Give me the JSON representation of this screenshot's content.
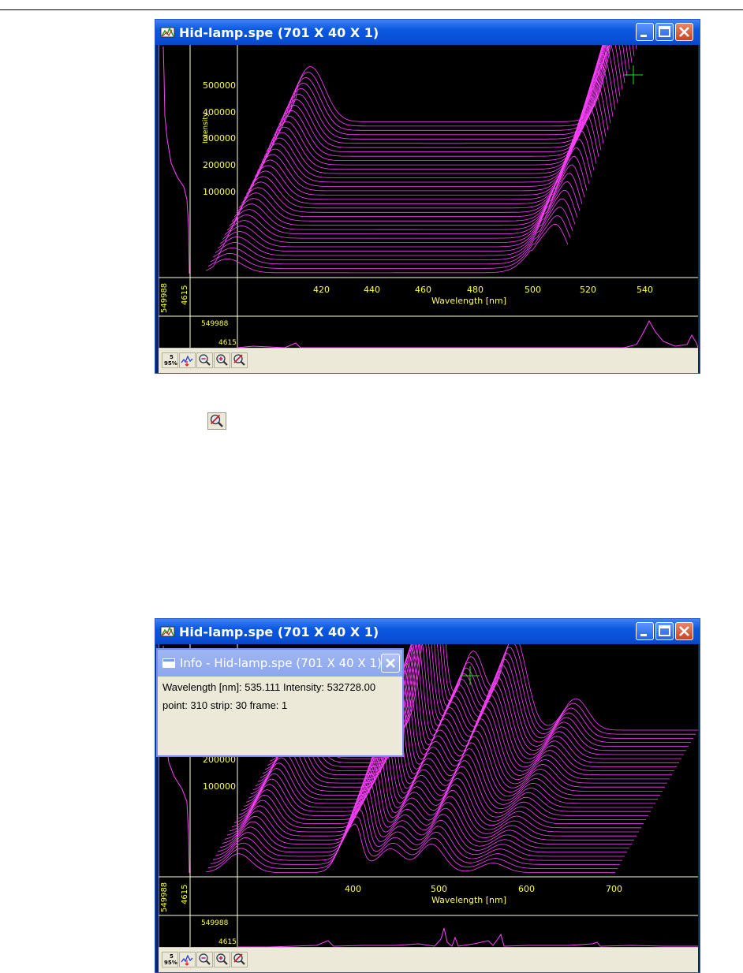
{
  "colors": {
    "trace": "#ff40ff",
    "axis": "#ffff40",
    "grid": "#ffffe0",
    "titlebar": "#0b58e0"
  },
  "windows": [
    {
      "title": "Hid-lamp.spe (701 X 40 X 1)",
      "y_ticks": [
        "500000",
        "400000",
        "300000",
        "200000",
        "100000"
      ],
      "y_axis_label": "Intensity",
      "x_ticks": [
        "420",
        "440",
        "460",
        "480",
        "500",
        "520",
        "540"
      ],
      "x_axis_label": "Wavelength [nm]",
      "side_max": "549988",
      "side_min": "4615",
      "strip_max": "549988",
      "strip_min": "4615"
    },
    {
      "title": "Hid-lamp.spe (701 X 40 X 1)",
      "y_ticks": [
        "200000",
        "100000"
      ],
      "y_axis_label": "",
      "x_ticks": [
        "400",
        "500",
        "600",
        "700"
      ],
      "x_axis_label": "Wavelength [nm]",
      "side_max": "549988",
      "side_min": "4615",
      "strip_max": "549988",
      "strip_min": "4615"
    }
  ],
  "toolbar": {
    "icons": [
      "percentile-scale-icon",
      "peak-marker-icon",
      "zoom-out-icon",
      "zoom-in-icon",
      "zoom-reset-icon"
    ]
  },
  "standalone_icon": "zoom-reset-icon",
  "info": {
    "title": "Info - Hid-lamp.spe (701 X 40 X 1)",
    "line1": "Wavelength [nm]: 535.111  Intensity: 532728.00",
    "line2": "point: 310  strip: 30  frame: 1"
  }
}
